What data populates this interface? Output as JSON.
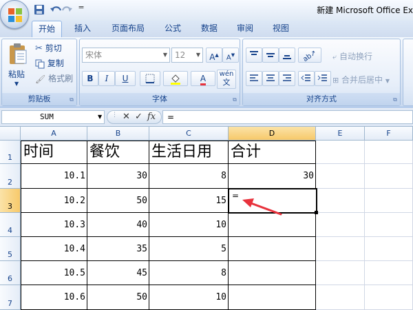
{
  "window": {
    "title": "新建 Microsoft Office Ex",
    "qat_more": "="
  },
  "tabs": [
    "开始",
    "插入",
    "页面布局",
    "公式",
    "数据",
    "审阅",
    "视图"
  ],
  "ribbon": {
    "clipboard": {
      "label": "剪贴板",
      "paste": "粘贴",
      "cut": "剪切",
      "copy": "复制",
      "format_painter": "格式刷"
    },
    "font": {
      "label": "字体",
      "font_name": "宋体",
      "font_size": "12",
      "bold": "B",
      "italic": "I",
      "underline": "U",
      "grow": "A",
      "shrink": "A",
      "font_color": "A",
      "phonetic": "wén"
    },
    "alignment": {
      "label": "对齐方式",
      "wrap_text": "自动换行",
      "merge_center": "合并后居中"
    }
  },
  "formula_bar": {
    "name_box": "SUM",
    "cancel": "✕",
    "enter": "✓",
    "fx": "fx",
    "formula": "="
  },
  "sheet": {
    "columns": [
      "A",
      "B",
      "C",
      "D",
      "E",
      "F"
    ],
    "rows": [
      "1",
      "2",
      "3",
      "4",
      "5",
      "6",
      "7"
    ],
    "active_column": "D",
    "active_row": "3",
    "headers": [
      "时间",
      "餐饮",
      "生活日用",
      "合计"
    ],
    "data": [
      [
        "10.1",
        "30",
        "8",
        "30"
      ],
      [
        "10.2",
        "50",
        "15",
        "="
      ],
      [
        "10.3",
        "40",
        "10",
        ""
      ],
      [
        "10.4",
        "35",
        "5",
        ""
      ],
      [
        "10.5",
        "45",
        "8",
        ""
      ],
      [
        "10.6",
        "50",
        "10",
        ""
      ]
    ]
  },
  "colors": {
    "accent": "#15428b",
    "selected_header": "#f7c96a",
    "annotation_arrow": "#e8323c",
    "grid_line": "#d0d7e5"
  }
}
